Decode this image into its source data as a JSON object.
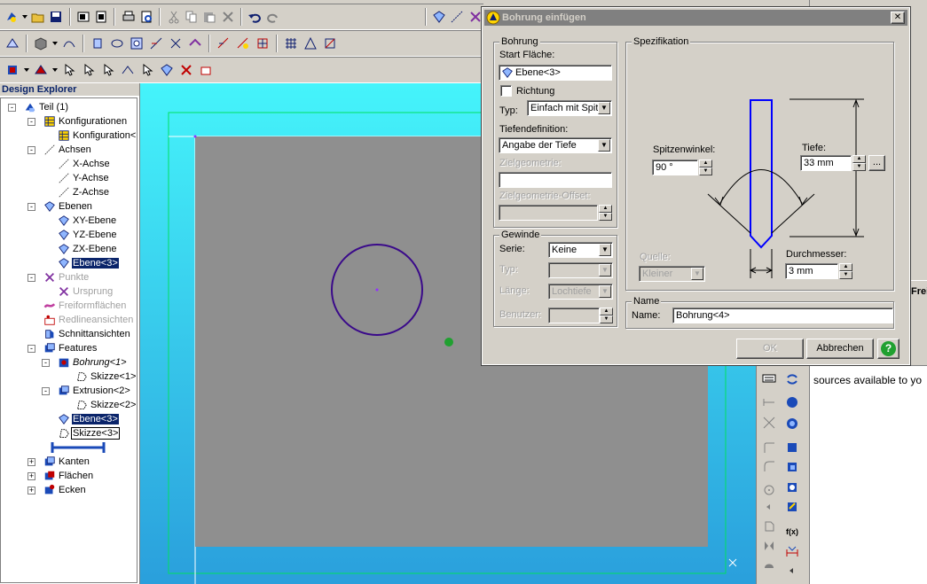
{
  "explorer": {
    "title": "Design Explorer",
    "tree": [
      {
        "label": "Teil (1)",
        "icon": "part-icon",
        "level": 0,
        "expand": "-"
      },
      {
        "label": "Konfigurationen",
        "icon": "table-icon",
        "level": 1,
        "expand": "-"
      },
      {
        "label": "Konfiguration<1",
        "icon": "table-icon",
        "level": 2
      },
      {
        "label": "Achsen",
        "icon": "axis-icon",
        "level": 1,
        "expand": "-"
      },
      {
        "label": "X-Achse",
        "icon": "axis-icon",
        "level": 2
      },
      {
        "label": "Y-Achse",
        "icon": "axis-icon",
        "level": 2
      },
      {
        "label": "Z-Achse",
        "icon": "axis-icon",
        "level": 2
      },
      {
        "label": "Ebenen",
        "icon": "plane-icon",
        "level": 1,
        "expand": "-"
      },
      {
        "label": "XY-Ebene",
        "icon": "plane-icon",
        "level": 2
      },
      {
        "label": "YZ-Ebene",
        "icon": "plane-icon",
        "level": 2
      },
      {
        "label": "ZX-Ebene",
        "icon": "plane-icon",
        "level": 2
      },
      {
        "label": "Ebene<3>",
        "icon": "plane-icon",
        "level": 2,
        "selected": true
      },
      {
        "label": "Punkte",
        "icon": "point-icon",
        "level": 1,
        "expand": "-",
        "dim": true
      },
      {
        "label": "Ursprung",
        "icon": "point-icon",
        "level": 2,
        "dim": true
      },
      {
        "label": "Freiformflächen",
        "icon": "freeform-icon",
        "level": 1,
        "dim": true
      },
      {
        "label": "Redlineansichten",
        "icon": "redline-icon",
        "level": 1,
        "dim": true
      },
      {
        "label": "Schnittansichten",
        "icon": "section-icon",
        "level": 1
      },
      {
        "label": "Features",
        "icon": "features-icon",
        "level": 1,
        "expand": "-"
      },
      {
        "label": "Bohrung<1>",
        "icon": "hole-icon",
        "level": 2,
        "expand": "-",
        "italic": true
      },
      {
        "label": "Skizze<1>",
        "icon": "sketch-icon",
        "level": 3
      },
      {
        "label": "Extrusion<2>",
        "icon": "extrude-icon",
        "level": 2,
        "expand": "-"
      },
      {
        "label": "Skizze<2>",
        "icon": "sketch-icon",
        "level": 3
      },
      {
        "label": "Ebene<3>",
        "icon": "plane-icon",
        "level": 2,
        "selected": true
      },
      {
        "label": "Skizze<3>",
        "icon": "sketch-icon",
        "level": 2,
        "boxed": true
      },
      {
        "label": "",
        "icon": "end-marker-icon",
        "level": 2
      },
      {
        "label": "Kanten",
        "icon": "edges-icon",
        "level": 1,
        "expand": "+"
      },
      {
        "label": "Flächen",
        "icon": "faces-icon",
        "level": 1,
        "expand": "+"
      },
      {
        "label": "Ecken",
        "icon": "vertices-icon",
        "level": 1,
        "expand": "+"
      }
    ]
  },
  "dialog": {
    "title": "Bohrung einfügen",
    "close": "✕",
    "bohrung": {
      "group_label": "Bohrung",
      "start_label": "Start Fläche:",
      "start_value": "Ebene<3>",
      "richtung_label": "Richtung",
      "typ_label": "Typ:",
      "typ_value": "Einfach mit Spit",
      "tiefe_def_label": "Tiefendefinition:",
      "tiefe_def_value": "Angabe der Tiefe",
      "zielgeo_label": "Zielgeometrie:",
      "zielgeo_value": "",
      "zielgeo_offset_label": "Zielgeometrie-Offset:",
      "zielgeo_offset_value": ""
    },
    "gewinde": {
      "group_label": "Gewinde",
      "serie_label": "Serie:",
      "serie_value": "Keine",
      "typ_label": "Typ:",
      "typ_value": "",
      "laenge_label": "Länge:",
      "laenge_value": "Lochtiefe",
      "benutzer_label": "Benutzer:",
      "benutzer_value": ""
    },
    "spezifikation": {
      "group_label": "Spezifikation",
      "spitzenwinkel_label": "Spitzenwinkel:",
      "spitzenwinkel_value": "90 °",
      "tiefe_label": "Tiefe:",
      "tiefe_value": "33 mm",
      "browse_label": "...",
      "quelle_label": "Quelle:",
      "quelle_value": "Kleiner",
      "durchmesser_label": "Durchmesser:",
      "durchmesser_value": "3 mm"
    },
    "name": {
      "group_label": "Name",
      "name_label": "Name:",
      "name_value": "Bohrung<4>"
    },
    "ok_label": "OK",
    "cancel_label": "Abbrechen",
    "help_label": "?"
  },
  "background": {
    "tab_fragment": "Frei",
    "text_fragment": "sources available to yo"
  },
  "colors": {
    "viewport_top": "#45f4fb",
    "viewport_bottom": "#2a9fdc",
    "sketch_circle": "#3a0a8a",
    "drill_outline": "#0000ff",
    "selection": "#0a246a"
  }
}
